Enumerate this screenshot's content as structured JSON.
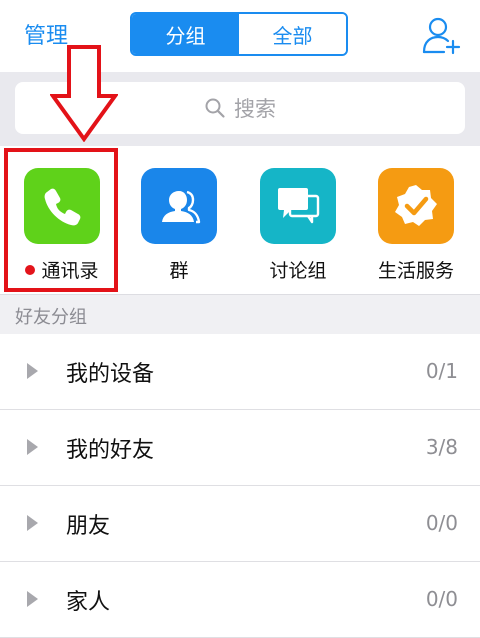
{
  "header": {
    "manage_label": "管理",
    "tabs": [
      {
        "label": "分组",
        "active": true
      },
      {
        "label": "全部",
        "active": false
      }
    ],
    "add_friend_icon": "add-contact-icon",
    "accent_color": "#1a8cf0"
  },
  "search": {
    "placeholder": "搜索",
    "icon": "search-icon"
  },
  "quick_items": [
    {
      "label": "通讯录",
      "icon": "phone-icon",
      "color": "#5fd21a",
      "notification_dot": true
    },
    {
      "label": "群",
      "icon": "group-icon",
      "color": "#1a86ea",
      "notification_dot": false
    },
    {
      "label": "讨论组",
      "icon": "chat-bubbles-icon",
      "color": "#15b5c7",
      "notification_dot": false
    },
    {
      "label": "生活服务",
      "icon": "badge-check-icon",
      "color": "#f59b12",
      "notification_dot": false
    }
  ],
  "section": {
    "title": "好友分组"
  },
  "groups": [
    {
      "name": "我的设备",
      "count": "0/1"
    },
    {
      "name": "我的好友",
      "count": "3/8"
    },
    {
      "name": "朋友",
      "count": "0/0"
    },
    {
      "name": "家人",
      "count": "0/0"
    }
  ],
  "annotation": {
    "color": "#e31218",
    "arrow_icon": "down-arrow-icon"
  }
}
